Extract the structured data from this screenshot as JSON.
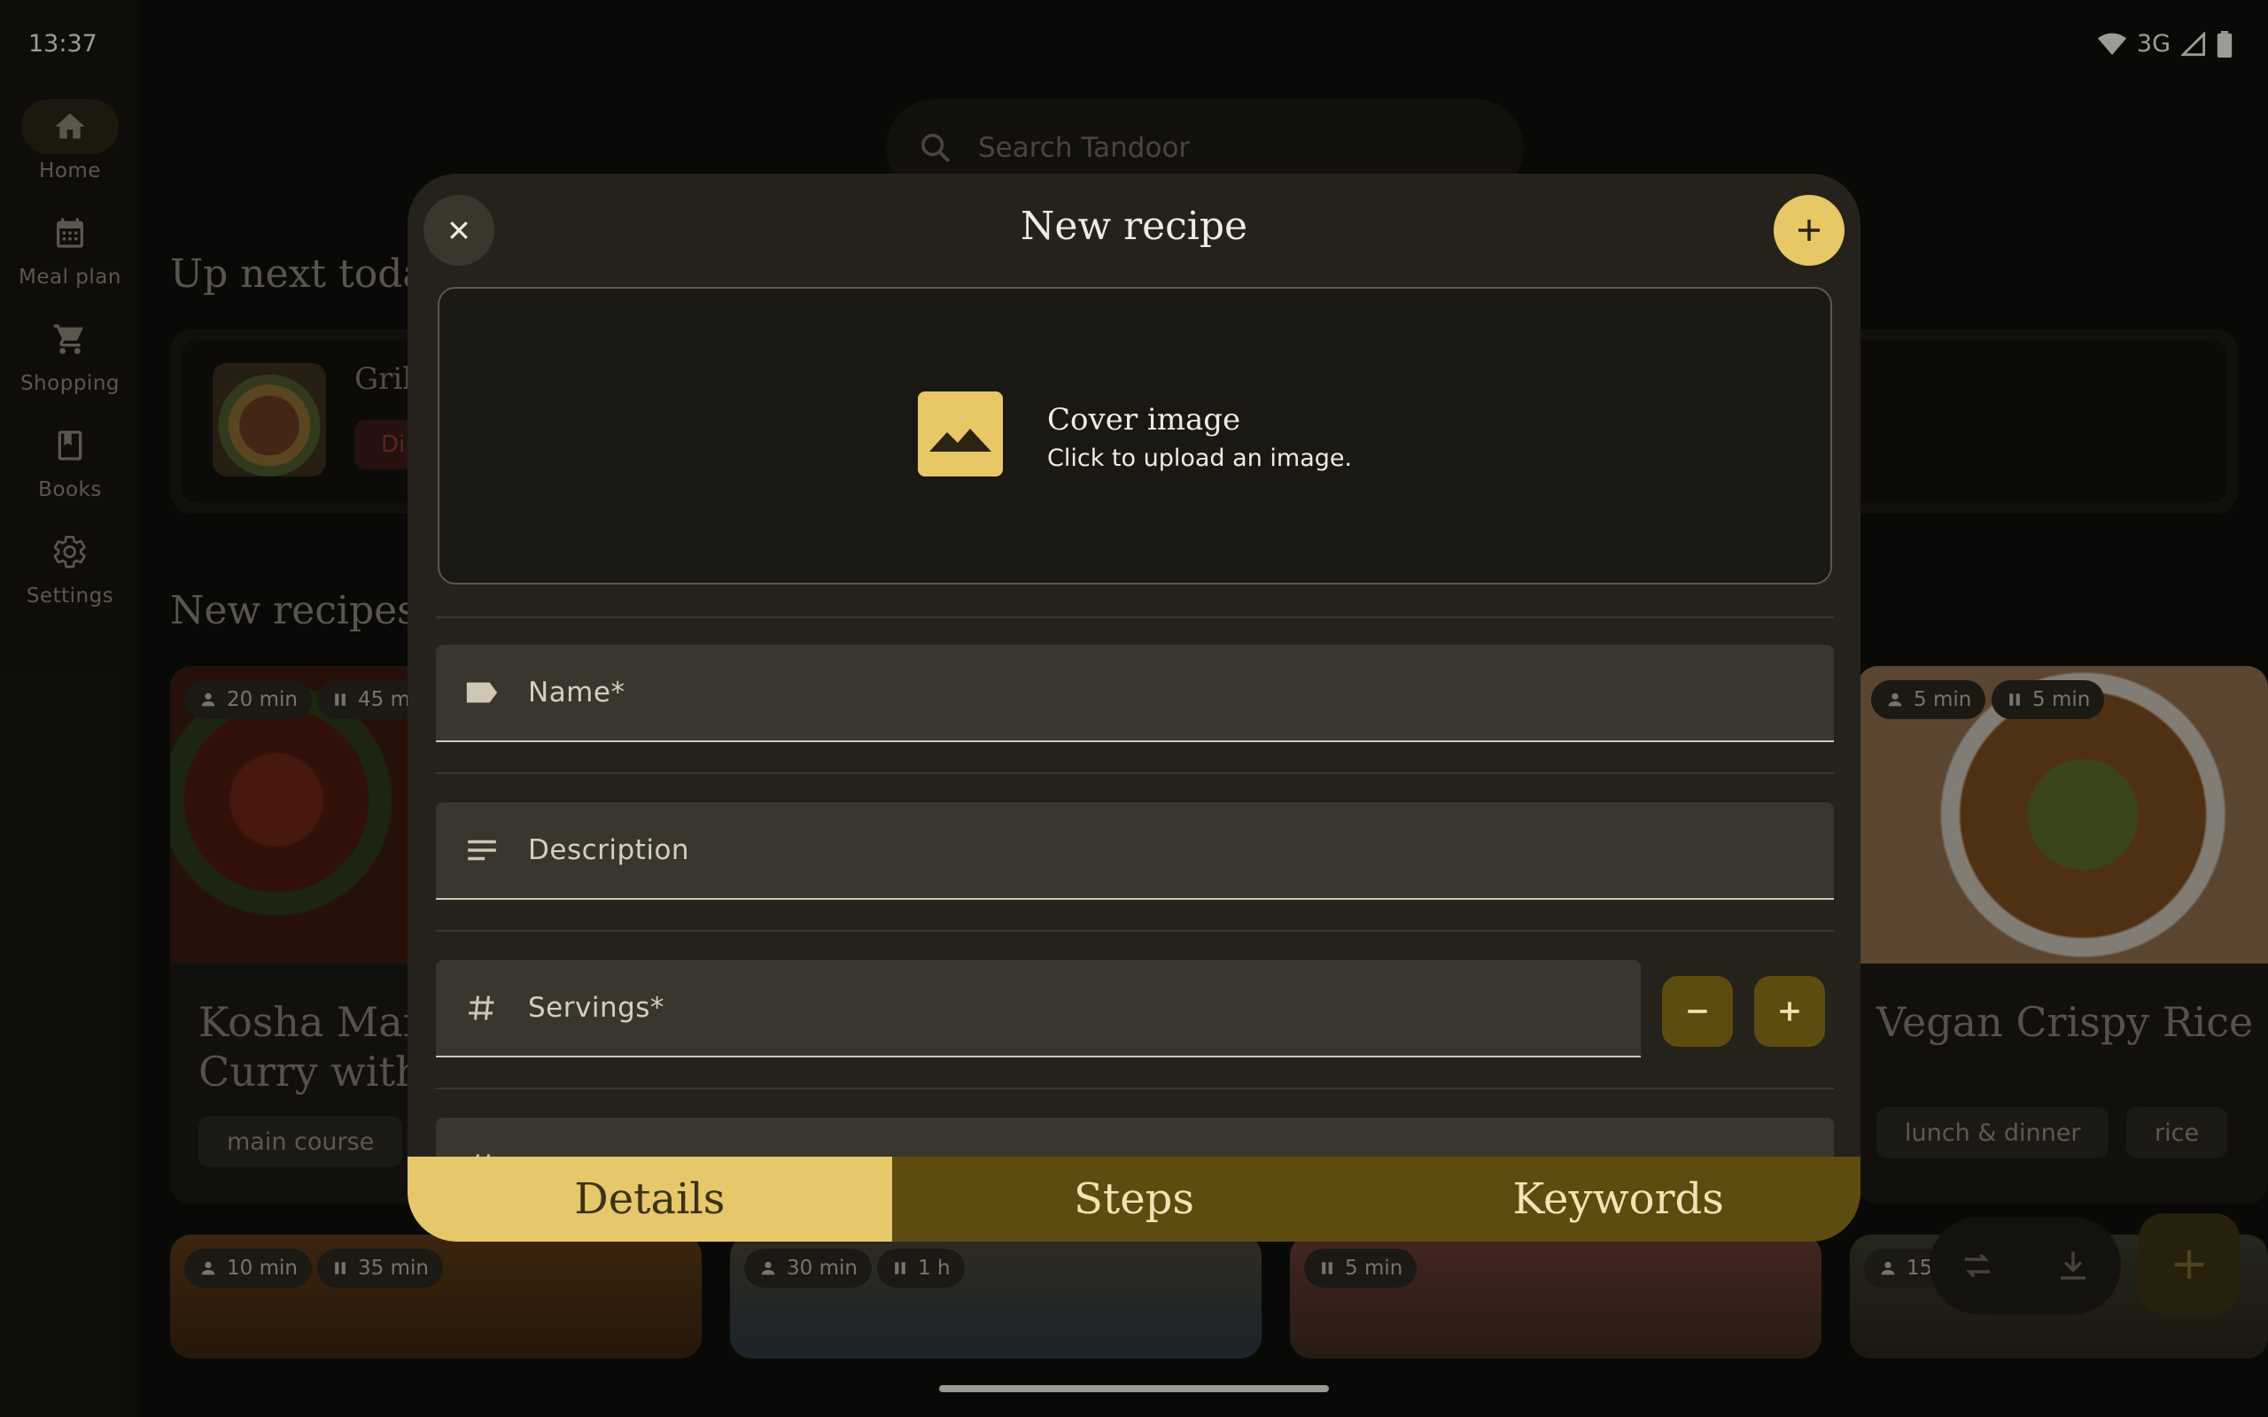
{
  "status_bar": {
    "time": "13:37",
    "network": "3G"
  },
  "nav_rail": {
    "items": [
      {
        "label": "Home",
        "icon": "home-icon",
        "active": true
      },
      {
        "label": "Meal plan",
        "icon": "calendar-icon",
        "active": false
      },
      {
        "label": "Shopping",
        "icon": "cart-icon",
        "active": false
      },
      {
        "label": "Books",
        "icon": "book-icon",
        "active": false
      },
      {
        "label": "Settings",
        "icon": "gear-icon",
        "active": false
      }
    ]
  },
  "background": {
    "search_placeholder": "Search Tandoor",
    "up_next_title": "Up next today",
    "up_next_item": {
      "name": "Gril",
      "chip": "Di"
    },
    "new_recipes_title": "New recipes",
    "cards": [
      {
        "prep": "20 min",
        "wait": "45 m",
        "title_line1": "Kosha Mang",
        "title_line2": "Curry with (",
        "tags": [
          "main course"
        ]
      },
      {
        "prep": "5 min",
        "wait": "5 min",
        "title_line1": "Vegan Crispy Rice Sala",
        "tags": [
          "lunch & dinner",
          "rice"
        ]
      }
    ],
    "bottom_cards": [
      {
        "prep": "10 min",
        "wait": "35 min"
      },
      {
        "prep": "30 min",
        "wait": "1 h"
      },
      {
        "wait": "5 min"
      },
      {
        "prep": "15"
      }
    ]
  },
  "dialog": {
    "title": "New recipe",
    "cover": {
      "title": "Cover image",
      "subtitle": "Click to upload an image."
    },
    "fields": {
      "name": "Name*",
      "description": "Description",
      "servings": "Servings*"
    },
    "tabs": [
      {
        "label": "Details",
        "active": true
      },
      {
        "label": "Steps",
        "active": false
      },
      {
        "label": "Keywords",
        "active": false
      }
    ]
  },
  "colors": {
    "accent": "#e7c766",
    "accent_dark": "#5c4c10",
    "surface": "#25221b",
    "background": "#0f0e0b"
  }
}
